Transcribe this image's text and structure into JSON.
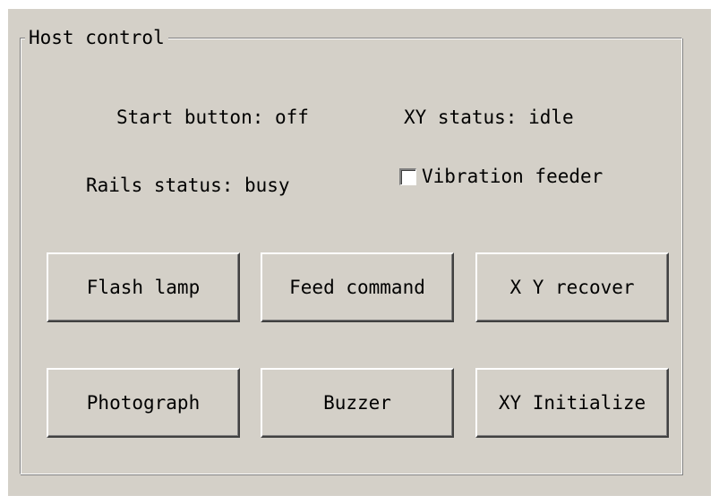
{
  "group": {
    "title": "Host control"
  },
  "status": {
    "start_button": "Start button: off",
    "xy_status": "XY status: idle",
    "rails_status": "Rails status: busy"
  },
  "checkbox": {
    "label": "Vibration feeder",
    "checked": false
  },
  "buttons": {
    "flash_lamp": "Flash lamp",
    "feed_command": "Feed command",
    "xy_recover": "X Y recover",
    "photograph": "Photograph",
    "buzzer": "Buzzer",
    "xy_initialize": "XY Initialize"
  }
}
